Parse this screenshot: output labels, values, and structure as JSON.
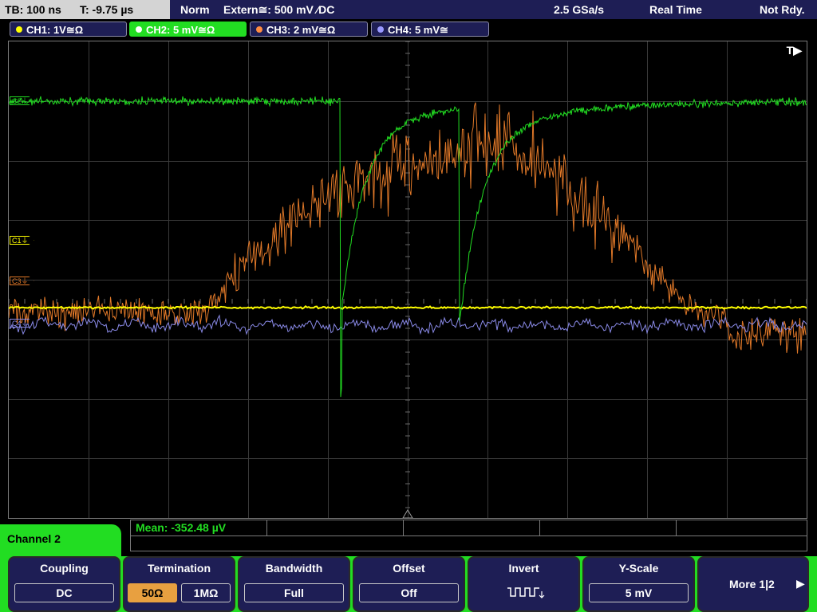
{
  "topbar": {
    "timebase": "TB: 100 ns",
    "trigger_time": "T: -9.75 µs",
    "trigger_mode": "Norm",
    "trigger_source": "Extern≅: 500 mV ⁄DC",
    "sample_rate": "2.5 GSa/s",
    "acq_mode": "Real Time",
    "status": "Not Rdy."
  },
  "channels": [
    {
      "label": "CH1: 1V≅Ω",
      "color": "#ffff00"
    },
    {
      "label": "CH2: 5 mV≅Ω",
      "color": "#22dd22"
    },
    {
      "label": "CH3: 2 mV≅Ω",
      "color": "#ff8c40"
    },
    {
      "label": "CH4: 5 mV≅",
      "color": "#9999ff"
    }
  ],
  "grid": {
    "trigger_indicator": "T▶",
    "markers": {
      "c1": "C1⏚",
      "c3": "C3⏚",
      "c2": "C2⏚",
      "c4": "C4⏚"
    }
  },
  "measurement": {
    "mean": "Mean: -352.48 µV"
  },
  "panel": {
    "title": "Channel 2"
  },
  "softkeys": {
    "coupling": {
      "title": "Coupling",
      "value": "DC"
    },
    "termination": {
      "title": "Termination",
      "opt1": "50Ω",
      "opt2": "1MΩ"
    },
    "bandwidth": {
      "title": "Bandwidth",
      "value": "Full"
    },
    "offset": {
      "title": "Offset",
      "value": "Off"
    },
    "invert": {
      "title": "Invert"
    },
    "yscale": {
      "title": "Y-Scale",
      "value": "5 mV"
    },
    "more": {
      "label": "More 1|2"
    }
  }
}
